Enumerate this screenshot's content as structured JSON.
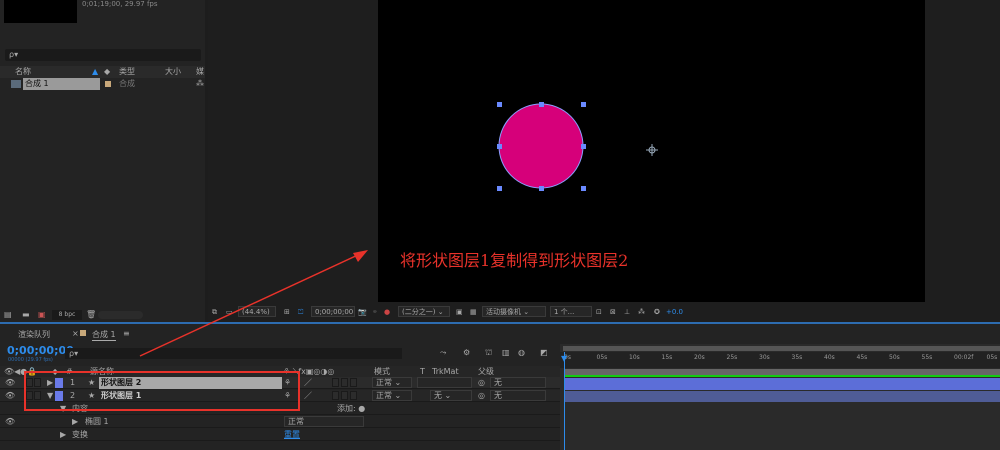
{
  "project": {
    "info": "0;01;19;00, 29.97 fps",
    "search_placeholder": "ρ▾",
    "columns": [
      "名称",
      "类型",
      "大小",
      "媒"
    ],
    "items": [
      {
        "name": "合成 1",
        "type": "合成"
      }
    ],
    "bpc": "8 bpc"
  },
  "viewer": {
    "zoom": "(44.4%)",
    "timecode": "0;00;00;00",
    "resolution": "(二分之一)",
    "camera": "活动摄像机",
    "views": "1 个...",
    "exposure": "+0.0",
    "shape_color": "#d6007a"
  },
  "annotation": "将形状图层1复制得到形状图层2",
  "timeline": {
    "tabs": [
      "渲染队列",
      "合成 1"
    ],
    "time": "0;00;00;00",
    "fps": "00000 (29.97 fps)",
    "search_placeholder": "ρ▾",
    "headers": {
      "num": "#",
      "source": "源名称",
      "mode": "模式",
      "t": "T",
      "trkmat": "TrkMat",
      "parent": "父级"
    },
    "layers": [
      {
        "num": "1",
        "name": "形状图层 2",
        "mode": "正常",
        "trkmat": "",
        "parent": "无"
      },
      {
        "num": "2",
        "name": "形状图层 1",
        "mode": "正常",
        "trkmat": "无",
        "parent": "无"
      }
    ],
    "contents": "内容",
    "add": "添加:",
    "ellipse": "椭圆 1",
    "ellipse_mode": "正常",
    "transform": "变换",
    "reset": "重置",
    "ruler": [
      "0s",
      "05s",
      "10s",
      "15s",
      "20s",
      "25s",
      "30s",
      "35s",
      "40s",
      "45s",
      "50s",
      "55s",
      "00:02f",
      "05s"
    ]
  }
}
